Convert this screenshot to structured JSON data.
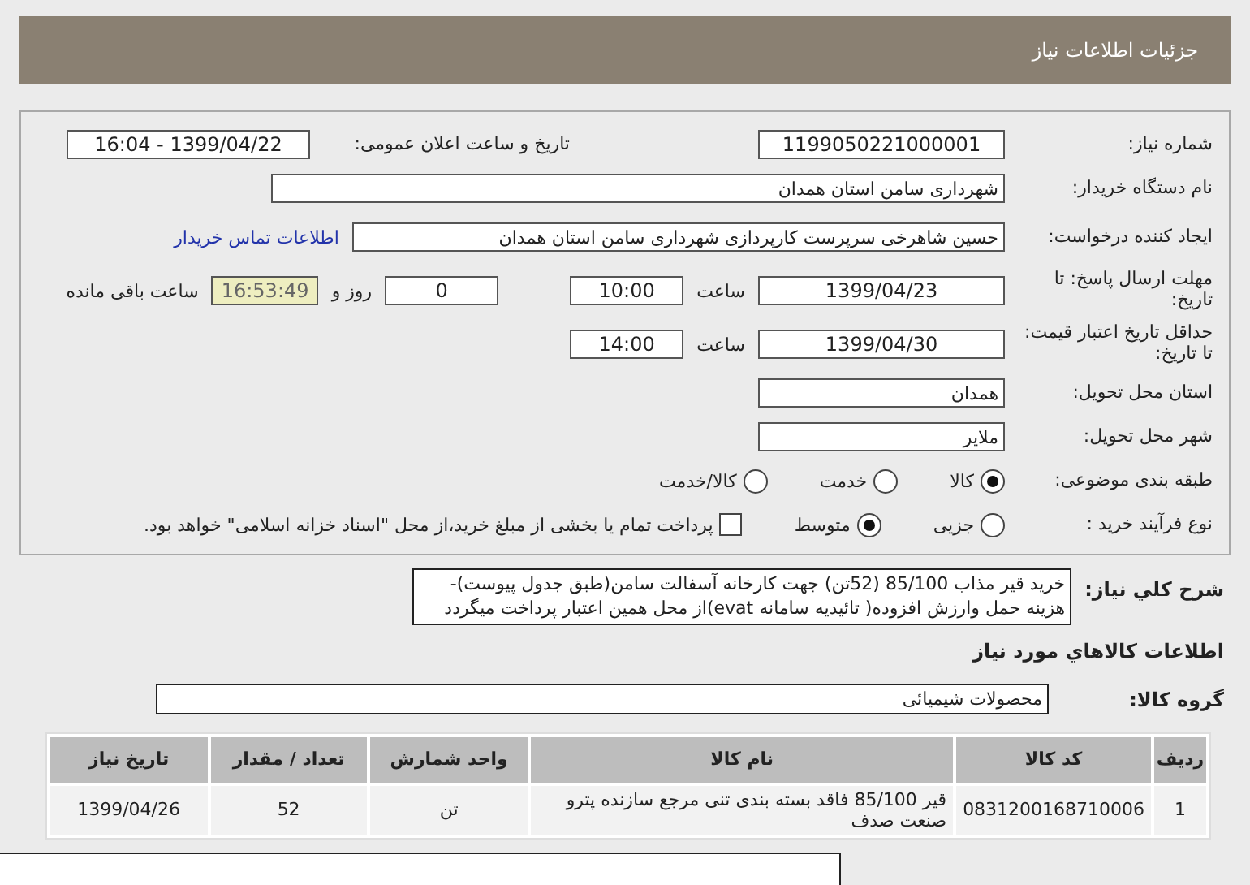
{
  "title": "جزئیات اطلاعات نیاز",
  "need_number": {
    "label": "شماره نیاز:",
    "value": "1199050221000001"
  },
  "announce": {
    "label": "تاریخ و ساعت اعلان عمومی:",
    "value": "1399/04/22 - 16:04"
  },
  "buyer": {
    "label": "نام دستگاه خریدار:",
    "value": "شهرداری سامن استان همدان"
  },
  "creator": {
    "label": "ایجاد کننده درخواست:",
    "value": "حسین شاهرخی سرپرست کارپردازی شهرداری سامن استان همدان",
    "link": "اطلاعات تماس خریدار"
  },
  "deadline": {
    "label": "مهلت ارسال پاسخ: تا تاریخ:",
    "date": "1399/04/23",
    "time_label": "ساعت",
    "time": "10:00",
    "days": "0",
    "days_label": "روز و",
    "remaining": "16:53:49",
    "remaining_label": "ساعت باقی مانده"
  },
  "validity": {
    "label": "حداقل تاریخ اعتبار قیمت: تا تاریخ:",
    "date": "1399/04/30",
    "time_label": "ساعت",
    "time": "14:00"
  },
  "province": {
    "label": "استان محل تحویل:",
    "value": "همدان"
  },
  "city": {
    "label": "شهر محل تحویل:",
    "value": "ملایر"
  },
  "category": {
    "label": "طبقه بندی موضوعی:",
    "options": [
      {
        "label": "کالا",
        "selected": true
      },
      {
        "label": "خدمت",
        "selected": false
      },
      {
        "label": "کالا/خدمت",
        "selected": false
      }
    ]
  },
  "process": {
    "label": "نوع فرآیند خرید :",
    "options": [
      {
        "label": "جزیی",
        "selected": false
      },
      {
        "label": "متوسط",
        "selected": true
      }
    ],
    "treasury": {
      "label": "پرداخت تمام یا بخشی از مبلغ خرید،از محل \"اسناد خزانه اسلامی\" خواهد بود.",
      "checked": false
    }
  },
  "description": {
    "label": "شرح کلي نياز:",
    "value": "خرید قیر مذاب 85/100 (52تن) جهت کارخانه آسفالت سامن(طبق جدول پیوست)-هزینه حمل وارزش افزوده( تائیدیه سامانه evat)از محل همین اعتبار پرداخت میگردد"
  },
  "goods_heading": "اطلاعات کالاهاي مورد نياز",
  "goods_group": {
    "label": "گروه کالا:",
    "value": "محصولات شیمیائی"
  },
  "table": {
    "columns": [
      "ردیف",
      "کد کالا",
      "نام کالا",
      "واحد شمارش",
      "تعداد / مقدار",
      "تاریخ نیاز"
    ],
    "rows": [
      [
        "1",
        "0831200168710006",
        "قیر 85/100 فاقد بسته بندی تنی مرجع سازنده پترو صنعت صدف",
        "تن",
        "52",
        "1399/04/26"
      ]
    ]
  }
}
